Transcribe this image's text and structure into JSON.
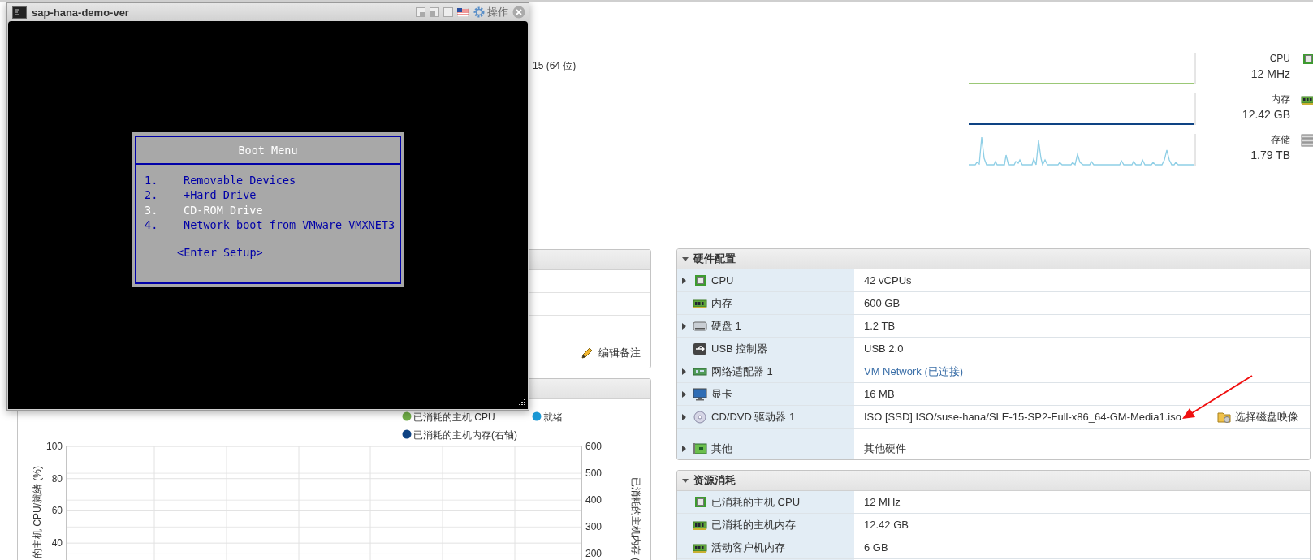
{
  "console_window": {
    "title": "sap-hana-demo-ver",
    "actions_label": "操作",
    "boot_menu": {
      "title": "Boot Menu",
      "items": [
        {
          "number": "1.",
          "label": "Removable Devices",
          "selected": false
        },
        {
          "number": "2.",
          "label": "+Hard Drive",
          "selected": false
        },
        {
          "number": "3.",
          "label": "CD-ROM Drive",
          "selected": true
        },
        {
          "number": "4.",
          "label": "Network boot from VMware VMXNET3",
          "selected": false
        }
      ],
      "setup": "<Enter Setup>"
    }
  },
  "summary": {
    "os_fragment": "15 (64 位)",
    "stats": [
      {
        "kind": "cpu",
        "label": "CPU",
        "value": "12 MHz"
      },
      {
        "kind": "memory",
        "label": "内存",
        "value": "12.42 GB"
      },
      {
        "kind": "storage",
        "label": "存储",
        "value": "1.79 TB"
      }
    ]
  },
  "notes_panel": {
    "edit_button": "编辑备注"
  },
  "performance_panel": {
    "chart_data": {
      "type": "line",
      "ylabel": "的主机 CPU/就绪 (%)",
      "ylim": [
        28.5,
        100
      ],
      "yticks": [
        40,
        60,
        80,
        100
      ],
      "y2lim": [
        171,
        600
      ],
      "grid": true,
      "y2label": "已消耗的主机内存 (",
      "y2ticks": [
        200,
        300,
        400,
        500,
        600
      ],
      "series": [
        {
          "name": "已消耗的主机 CPU",
          "color": "#70ad47"
        },
        {
          "name": "就绪",
          "color": "#1a98d5"
        },
        {
          "name": "已消耗的主机内存(右轴)",
          "color": "#0e4383"
        }
      ]
    }
  },
  "hardware": {
    "title": "硬件配置",
    "expanded": true,
    "rows": [
      {
        "kind": "cpu",
        "label": "CPU",
        "value": "42 vCPUs",
        "expandable": true
      },
      {
        "kind": "memory",
        "label": "内存",
        "value": "600 GB",
        "expandable": false
      },
      {
        "kind": "disk",
        "label": "硬盘 1",
        "value": "1.2 TB",
        "expandable": true
      },
      {
        "kind": "usb",
        "label": "USB 控制器",
        "value": "USB 2.0",
        "expandable": false
      },
      {
        "kind": "network",
        "label": "网络适配器 1",
        "value": "VM Network (已连接)",
        "link": true,
        "expandable": true
      },
      {
        "kind": "display",
        "label": "显卡",
        "value": "16 MB",
        "expandable": true
      },
      {
        "kind": "cdrom",
        "label": "CD/DVD 驱动器 1",
        "value": "ISO [SSD] ISO/suse-hana/SLE-15-SP2-Full-x86_64-GM-Media1.iso",
        "action": "选择磁盘映像",
        "expandable": true
      },
      {
        "kind": "blank"
      },
      {
        "kind": "other",
        "label": "其他",
        "value": "其他硬件",
        "expandable": true
      }
    ]
  },
  "resources": {
    "title": "资源消耗",
    "expanded": true,
    "rows": [
      {
        "kind": "cpu",
        "label": "已消耗的主机 CPU",
        "value": "12 MHz"
      },
      {
        "kind": "memory",
        "label": "已消耗的主机内存",
        "value": "12.42 GB"
      },
      {
        "kind": "memory",
        "label": "活动客户机内存",
        "value": "6 GB"
      },
      {
        "kind": "blank"
      }
    ]
  }
}
